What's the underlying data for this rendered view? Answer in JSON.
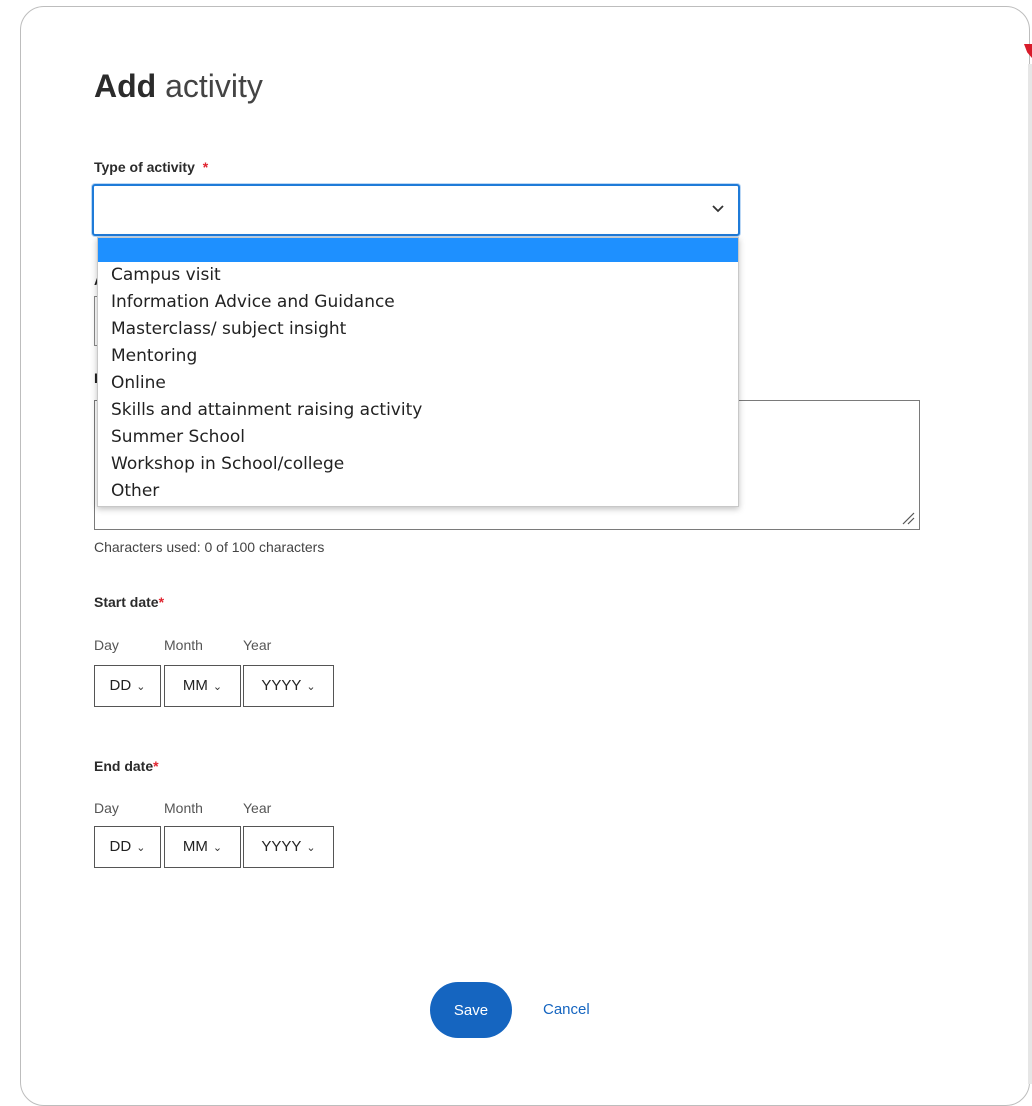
{
  "form": {
    "title_bold": "Add",
    "title_light": " activity",
    "type_label": "Type of activity",
    "required_marker": "*",
    "type_value": "",
    "hidden_label_1": "A",
    "hidden_label_2": "I",
    "description_value": "",
    "help_text": "Characters used: 0 of 100 characters"
  },
  "dropdown": {
    "options": [
      "",
      "Campus visit",
      "Information Advice and Guidance",
      "Masterclass/ subject insight",
      "Mentoring",
      "Online",
      "Skills and attainment raising activity",
      "Summer School",
      "Workshop in School/college",
      "Other"
    ]
  },
  "start_date": {
    "label": "Start date",
    "day_label": "Day",
    "month_label": "Month",
    "year_label": "Year",
    "day_value": "DD",
    "month_value": "MM",
    "year_value": "YYYY"
  },
  "end_date": {
    "label": "End date",
    "day_label": "Day",
    "month_label": "Month",
    "year_label": "Year",
    "day_value": "DD",
    "month_value": "MM",
    "year_value": "YYYY"
  },
  "actions": {
    "save_label": "Save",
    "cancel_label": "Cancel"
  },
  "colors": {
    "accent": "#1565c0",
    "focus_border": "#1f7bd8",
    "highlight": "#1e90ff",
    "required": "#e0242f"
  },
  "icons": {
    "select_chevron": "chevron-down-icon",
    "resize": "resize-grip-icon"
  }
}
